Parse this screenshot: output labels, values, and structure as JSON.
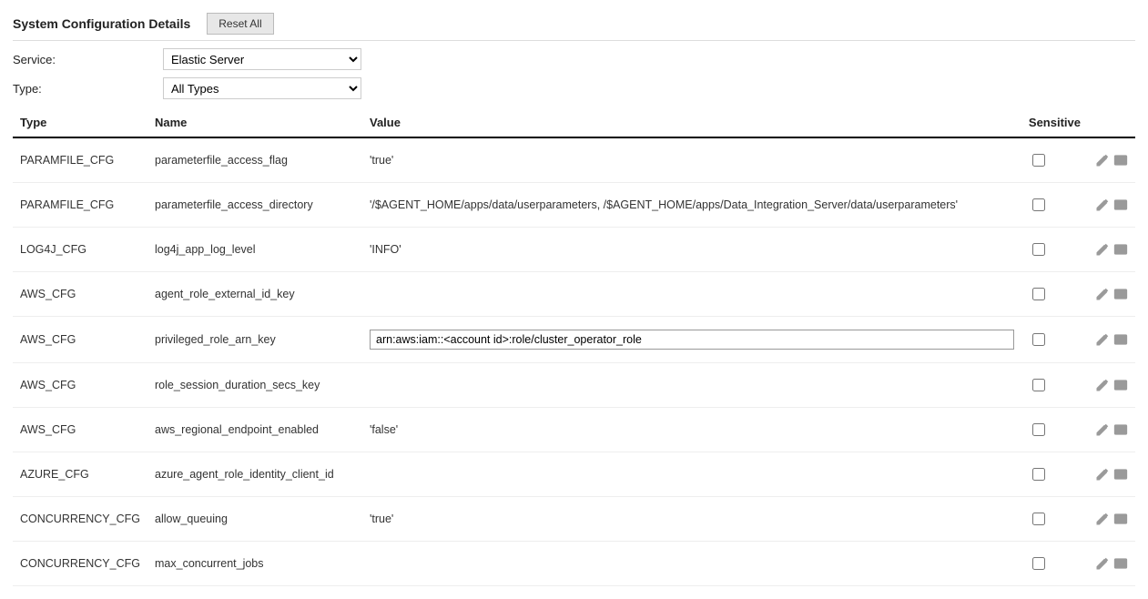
{
  "header": {
    "title": "System Configuration Details",
    "reset_label": "Reset All"
  },
  "filters": {
    "service_label": "Service:",
    "service_value": "Elastic Server",
    "type_label": "Type:",
    "type_value": "All Types"
  },
  "table": {
    "columns": {
      "type": "Type",
      "name": "Name",
      "value": "Value",
      "sensitive": "Sensitive"
    },
    "rows": [
      {
        "type": "PARAMFILE_CFG",
        "name": "parameterfile_access_flag",
        "value": "'true'",
        "sensitive": false,
        "editing": false
      },
      {
        "type": "PARAMFILE_CFG",
        "name": "parameterfile_access_directory",
        "value": "'/$AGENT_HOME/apps/data/userparameters, /$AGENT_HOME/apps/Data_Integration_Server/data/userparameters'",
        "sensitive": false,
        "editing": false
      },
      {
        "type": "LOG4J_CFG",
        "name": "log4j_app_log_level",
        "value": "'INFO'",
        "sensitive": false,
        "editing": false
      },
      {
        "type": "AWS_CFG",
        "name": "agent_role_external_id_key",
        "value": "",
        "sensitive": false,
        "editing": false
      },
      {
        "type": "AWS_CFG",
        "name": "privileged_role_arn_key",
        "value": "arn:aws:iam::<account id>:role/cluster_operator_role",
        "sensitive": false,
        "editing": true
      },
      {
        "type": "AWS_CFG",
        "name": "role_session_duration_secs_key",
        "value": "",
        "sensitive": false,
        "editing": false
      },
      {
        "type": "AWS_CFG",
        "name": "aws_regional_endpoint_enabled",
        "value": "'false'",
        "sensitive": false,
        "editing": false
      },
      {
        "type": "AZURE_CFG",
        "name": "azure_agent_role_identity_client_id",
        "value": "",
        "sensitive": false,
        "editing": false
      },
      {
        "type": "CONCURRENCY_CFG",
        "name": "allow_queuing",
        "value": "'true'",
        "sensitive": false,
        "editing": false
      },
      {
        "type": "CONCURRENCY_CFG",
        "name": "max_concurrent_jobs",
        "value": "",
        "sensitive": false,
        "editing": false
      }
    ]
  }
}
